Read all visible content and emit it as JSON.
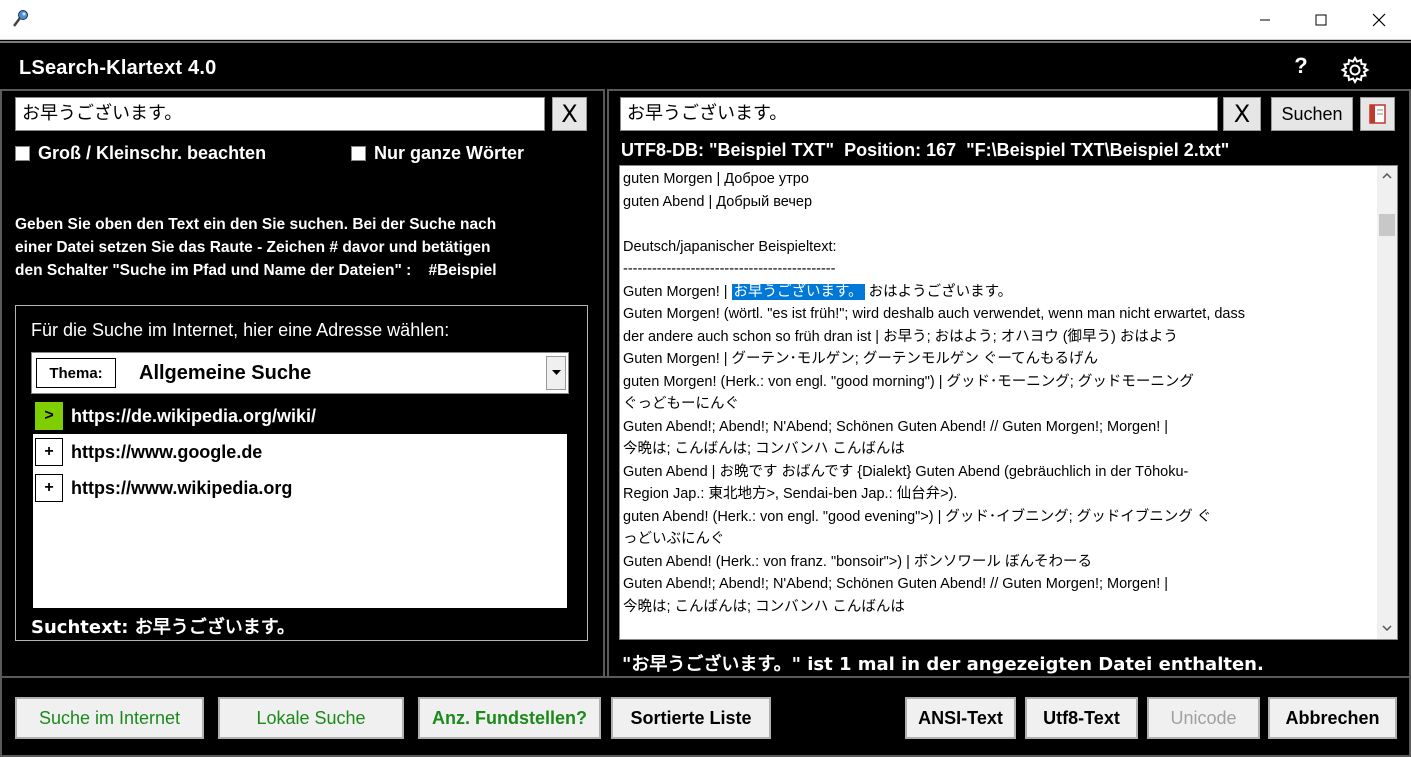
{
  "window": {
    "minimize_icon": "minimize-icon",
    "maximize_icon": "maximize-icon",
    "close_icon": "close-icon"
  },
  "header": {
    "title": "LSearch-Klartext 4.0",
    "help_label": "?",
    "settings_icon": "gear-icon"
  },
  "left": {
    "search_value": "お早うございます。",
    "clear_label": "X",
    "checkbox_case": "Groß / Kleinschr. beachten",
    "checkbox_whole": "Nur ganze Wörter",
    "info_lines": [
      "Geben Sie oben den Text ein den Sie suchen. Bei der Suche nach",
      "einer Datei setzen Sie das Raute - Zeichen # davor und betätigen",
      "den Schalter \"Suche im Pfad und Name der Dateien\" :    #Beispiel"
    ],
    "web": {
      "caption": "Für die Suche im Internet, hier eine Adresse wählen:",
      "theme_label": "Thema:",
      "theme_value": "Allgemeine Suche",
      "urls": [
        {
          "marker": ">",
          "url": "https://de.wikipedia.org/wiki/",
          "selected": true
        },
        {
          "marker": "+",
          "url": "https://www.google.de",
          "selected": false
        },
        {
          "marker": "+",
          "url": "https://www.wikipedia.org",
          "selected": false
        }
      ],
      "suchtext": "Suchtext: お早うございます。"
    }
  },
  "right": {
    "search_value": "お早うございます。",
    "clear_label": "X",
    "search_button": "Suchen",
    "book_icon": "book-icon",
    "db_info": "UTF8-DB: \"Beispiel TXT\"  Position: 167  \"F:\\Beispiel TXT\\Beispiel 2.txt\"",
    "doc_lines": [
      "guten Morgen | Доброе утро",
      "guten Abend | Добрый вечер",
      "",
      "Deutsch/japanischer Beispieltext:",
      "--------------------------------------------",
      "Guten Morgen! | ",
      "Guten Morgen! (wörtl. \"es ist früh!\"; wird deshalb auch verwendet, wenn man nicht erwartet, dass",
      "der andere auch schon so früh dran ist | お早う; おはよう; オハヨウ (御早う) おはよう",
      "Guten Morgen! | グーテン･モルゲン; グーテンモルゲン ぐーてんもるげん",
      "guten Morgen! (Herk.: von engl. \"good morning\") | グッド･モーニング; グッドモーニング",
      "ぐっどもーにんぐ",
      "Guten Abend!; Abend!; N'Abend; Schönen Guten Abend! // Guten Morgen!; Morgen! |",
      "今晩は; こんばんは; コンバンハ こんばんは",
      "Guten Abend | お晩です おばんです {Dialekt} Guten Abend (gebräuchlich in der Tōhoku-",
      "Region Jap.: 東北地方>, Sendai-ben Jap.: 仙台弁>).",
      "guten Abend! (Herk.: von engl. \"good evening\">) | グッド･イブニング; グッドイブニング ぐ",
      "っどいぶにんぐ",
      "Guten Abend! (Herk.: von franz. \"bonsoir\">) | ボンソワール ぼんそわーる",
      "Guten Abend!; Abend!; N'Abend; Schönen Guten Abend! // Guten Morgen!; Morgen! |",
      "今晩は; こんばんは; コンバンハ こんばんは"
    ],
    "highlight_text": "お早うございます。",
    "highlight_after": " おはようございます。",
    "found_text": "\"お早うございます。\" ist 1 mal in der angezeigten Datei enthalten."
  },
  "buttons": {
    "internet": "Suche im Internet",
    "local": "Lokale Suche",
    "count": "Anz. Fundstellen?",
    "sorted": "Sortierte Liste",
    "ansi": "ANSI-Text",
    "utf8": "Utf8-Text",
    "unicode": "Unicode",
    "cancel": "Abbrechen"
  }
}
